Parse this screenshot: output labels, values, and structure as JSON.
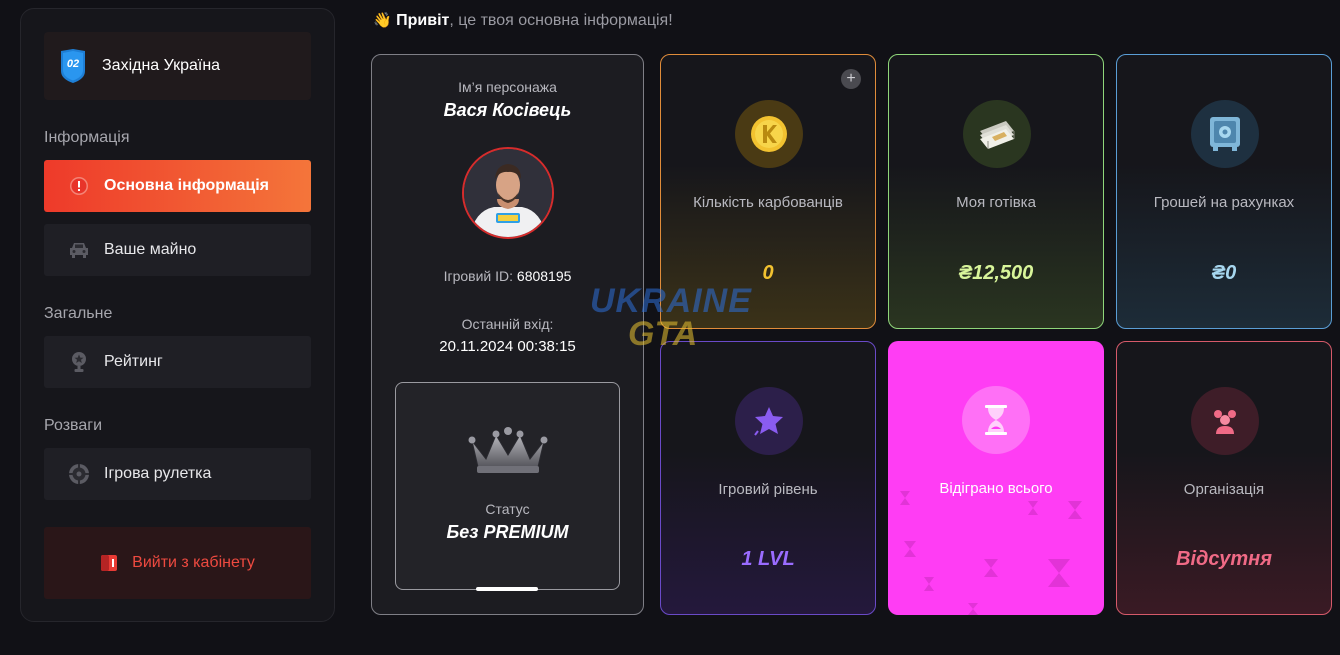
{
  "sidebar": {
    "server": {
      "badge": "02",
      "name": "Західна Україна"
    },
    "sections": [
      {
        "title": "Інформація"
      },
      {
        "title": "Загальне"
      },
      {
        "title": "Розваги"
      }
    ],
    "items": [
      {
        "label": "Основна інформація",
        "icon": "alert-icon"
      },
      {
        "label": "Ваше майно",
        "icon": "car-icon"
      },
      {
        "label": "Рейтинг",
        "icon": "trophy-icon"
      },
      {
        "label": "Ігрова рулетка",
        "icon": "roulette-icon"
      }
    ],
    "logout": {
      "label": "Вийти з кабінету",
      "icon": "exit-icon"
    }
  },
  "greeting": {
    "bold": "Привіт",
    "rest": ", це твоя основна інформація!"
  },
  "profile": {
    "name_label": "Ім’я персонажа",
    "name": "Вася Косівець",
    "id_label": "Ігровий ID:",
    "id_value": "6808195",
    "last_login_label": "Останній вхід:",
    "last_login": "20.11.2024 00:38:15",
    "status_label": "Статус",
    "status": "Без PREMIUM"
  },
  "cards": [
    {
      "title": "Кількість карбованців",
      "value": "0",
      "icon": "karbovanets-coin-icon",
      "accent": "#f2c230"
    },
    {
      "title": "Моя готівка",
      "value": "₴12,500",
      "icon": "cash-stack-icon",
      "accent": "#d8f59a"
    },
    {
      "title": "Грошей на рахунках",
      "value": "₴0",
      "icon": "safe-icon",
      "accent": "#a7d7ef"
    },
    {
      "title": "Ігровий рівень",
      "value": "1 LVL",
      "icon": "star-level-icon",
      "accent": "#8a5cf0"
    },
    {
      "title": "Відіграно всього",
      "value": "",
      "icon": "hourglass-icon",
      "accent": "#ff3df4"
    },
    {
      "title": "Організація",
      "value": "Відсутня",
      "icon": "group-icon",
      "accent": "#f06a86"
    }
  ],
  "watermark": {
    "line1": "UKRAINE",
    "line2": "GTA"
  }
}
